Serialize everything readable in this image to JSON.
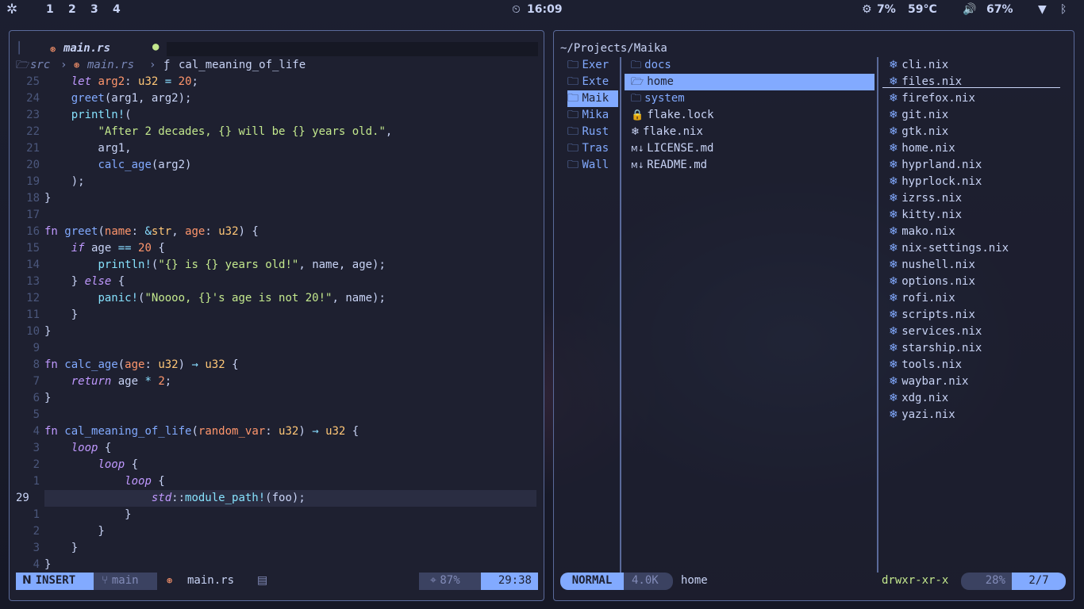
{
  "topbar": {
    "workspaces": [
      "1",
      "2",
      "3",
      "4"
    ],
    "clock": "16:09",
    "cpu": "7%",
    "temp": "59°C",
    "volume": "67%"
  },
  "editor": {
    "tab_title": "main.rs",
    "breadcrumb": [
      "src",
      "main.rs",
      "cal_meaning_of_life"
    ],
    "lines": [
      {
        "n": "25",
        "t": "    let arg2: u32 = 20;"
      },
      {
        "n": "24",
        "t": "    greet(arg1, arg2);"
      },
      {
        "n": "23",
        "t": "    println!("
      },
      {
        "n": "22",
        "t": "        \"After 2 decades, {} will be {} years old.\","
      },
      {
        "n": "21",
        "t": "        arg1,"
      },
      {
        "n": "20",
        "t": "        calc_age(arg2)"
      },
      {
        "n": "19",
        "t": "    );"
      },
      {
        "n": "18",
        "t": "}"
      },
      {
        "n": "17",
        "t": ""
      },
      {
        "n": "16",
        "t": "fn greet(name: &str, age: u32) {"
      },
      {
        "n": "15",
        "t": "    if age == 20 {"
      },
      {
        "n": "14",
        "t": "        println!(\"{} is {} years old!\", name, age);"
      },
      {
        "n": "13",
        "t": "    } else {"
      },
      {
        "n": "12",
        "t": "        panic!(\"Noooo, {}'s age is not 20!\", name);"
      },
      {
        "n": "11",
        "t": "    }"
      },
      {
        "n": "10",
        "t": "}"
      },
      {
        "n": "9",
        "t": ""
      },
      {
        "n": "8",
        "t": "fn calc_age(age: u32) → u32 {"
      },
      {
        "n": "7",
        "t": "    return age * 2;"
      },
      {
        "n": "6",
        "t": "}"
      },
      {
        "n": "5",
        "t": ""
      },
      {
        "n": "4",
        "t": "fn cal_meaning_of_life(random_var: u32) → u32 {"
      },
      {
        "n": "3",
        "t": "    loop {"
      },
      {
        "n": "2",
        "t": "        loop {"
      },
      {
        "n": "1",
        "t": "            loop {"
      },
      {
        "n": "29",
        "t": "                std::module_path!(foo);"
      },
      {
        "n": "1",
        "t": "            }"
      },
      {
        "n": "2",
        "t": "        }"
      },
      {
        "n": "3",
        "t": "    }"
      },
      {
        "n": "4",
        "t": "}"
      }
    ],
    "status": {
      "mode": "INSERT",
      "branch": "main",
      "file": "main.rs",
      "percent": "87%",
      "position": "29:38"
    }
  },
  "filemanager": {
    "path": "~/Projects/Maika",
    "parent_items": [
      "Exer",
      "Exte",
      "Maik",
      "Mika",
      "Rust",
      "Tras",
      "Wall"
    ],
    "current_items": [
      {
        "name": "docs",
        "icon": "folder-icon"
      },
      {
        "name": "home",
        "icon": "folder-open-icon"
      },
      {
        "name": "system",
        "icon": "folder-icon"
      },
      {
        "name": "flake.lock",
        "icon": "lock-icon"
      },
      {
        "name": "flake.nix",
        "icon": "nix-icon"
      },
      {
        "name": "LICENSE.md",
        "icon": "markdown-icon"
      },
      {
        "name": "README.md",
        "icon": "markdown-icon"
      }
    ],
    "preview_items": [
      "cli.nix",
      "files.nix",
      "firefox.nix",
      "git.nix",
      "gtk.nix",
      "home.nix",
      "hyprland.nix",
      "hyprlock.nix",
      "izrss.nix",
      "kitty.nix",
      "mako.nix",
      "nix-settings.nix",
      "nushell.nix",
      "options.nix",
      "rofi.nix",
      "scripts.nix",
      "services.nix",
      "starship.nix",
      "tools.nix",
      "waybar.nix",
      "xdg.nix",
      "yazi.nix"
    ],
    "status": {
      "mode": "NORMAL",
      "size": "4.0K",
      "name": "home",
      "perms": "drwxr-xr-x",
      "percent": "28%",
      "position": "2/7"
    }
  },
  "colors": {
    "accent": "#82aaff",
    "bg": "#1e2030",
    "border": "#5a6a9a"
  }
}
